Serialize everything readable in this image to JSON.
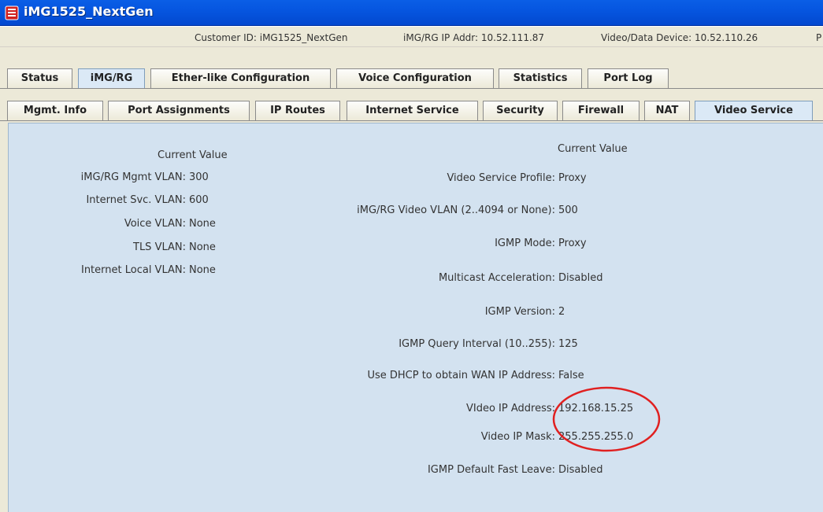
{
  "window": {
    "title": "iMG1525_NextGen"
  },
  "info_bar": {
    "customer_id": "Customer ID: iMG1525_NextGen",
    "ip_addr": "iMG/RG IP Addr: 10.52.111.87",
    "video_device": "Video/Data Device: 10.52.110.26",
    "truncated": "P"
  },
  "main_tabs": [
    "Status",
    "iMG/RG",
    "Ether-like Configuration",
    "Voice Configuration",
    "Statistics",
    "Port Log"
  ],
  "sub_tabs": [
    "Mgmt. Info",
    "Port Assignments",
    "IP Routes",
    "Internet Service",
    "Security",
    "Firewall",
    "NAT",
    "Video Service"
  ],
  "selected": {
    "main_tab": "iMG/RG",
    "sub_tab": "Video Service"
  },
  "left_panel": {
    "header": "Current Value",
    "fields": [
      {
        "label": "iMG/RG Mgmt VLAN:",
        "value": "300"
      },
      {
        "label": "Internet Svc. VLAN:",
        "value": "600"
      },
      {
        "label": "Voice VLAN:",
        "value": "None"
      },
      {
        "label": "TLS VLAN:",
        "value": "None"
      },
      {
        "label": "Internet Local VLAN:",
        "value": "None"
      }
    ]
  },
  "right_panel": {
    "header": "Current Value",
    "fields": [
      {
        "label": "Video Service Profile:",
        "value": "Proxy"
      },
      {
        "label": "iMG/RG Video VLAN (2..4094 or None):",
        "value": "500"
      },
      {
        "label": "IGMP Mode:",
        "value": "Proxy"
      },
      {
        "label": "Multicast Acceleration:",
        "value": "Disabled"
      },
      {
        "label": "IGMP Version:",
        "value": "2"
      },
      {
        "label": "IGMP Query Interval (10..255):",
        "value": "125"
      },
      {
        "label": "Use DHCP to obtain WAN IP Address:",
        "value": "False"
      },
      {
        "label": "VIdeo IP Address:",
        "value": "192.168.15.25"
      },
      {
        "label": "Video IP Mask:",
        "value": "255.255.255.0"
      },
      {
        "label": "IGMP Default Fast Leave:",
        "value": "Disabled"
      }
    ]
  },
  "colors": {
    "titlebar": "#0656e0",
    "content_bg": "#d3e2f0",
    "annotation_circle": "#e02020"
  },
  "icons": {
    "window_icon": "app-icon"
  }
}
